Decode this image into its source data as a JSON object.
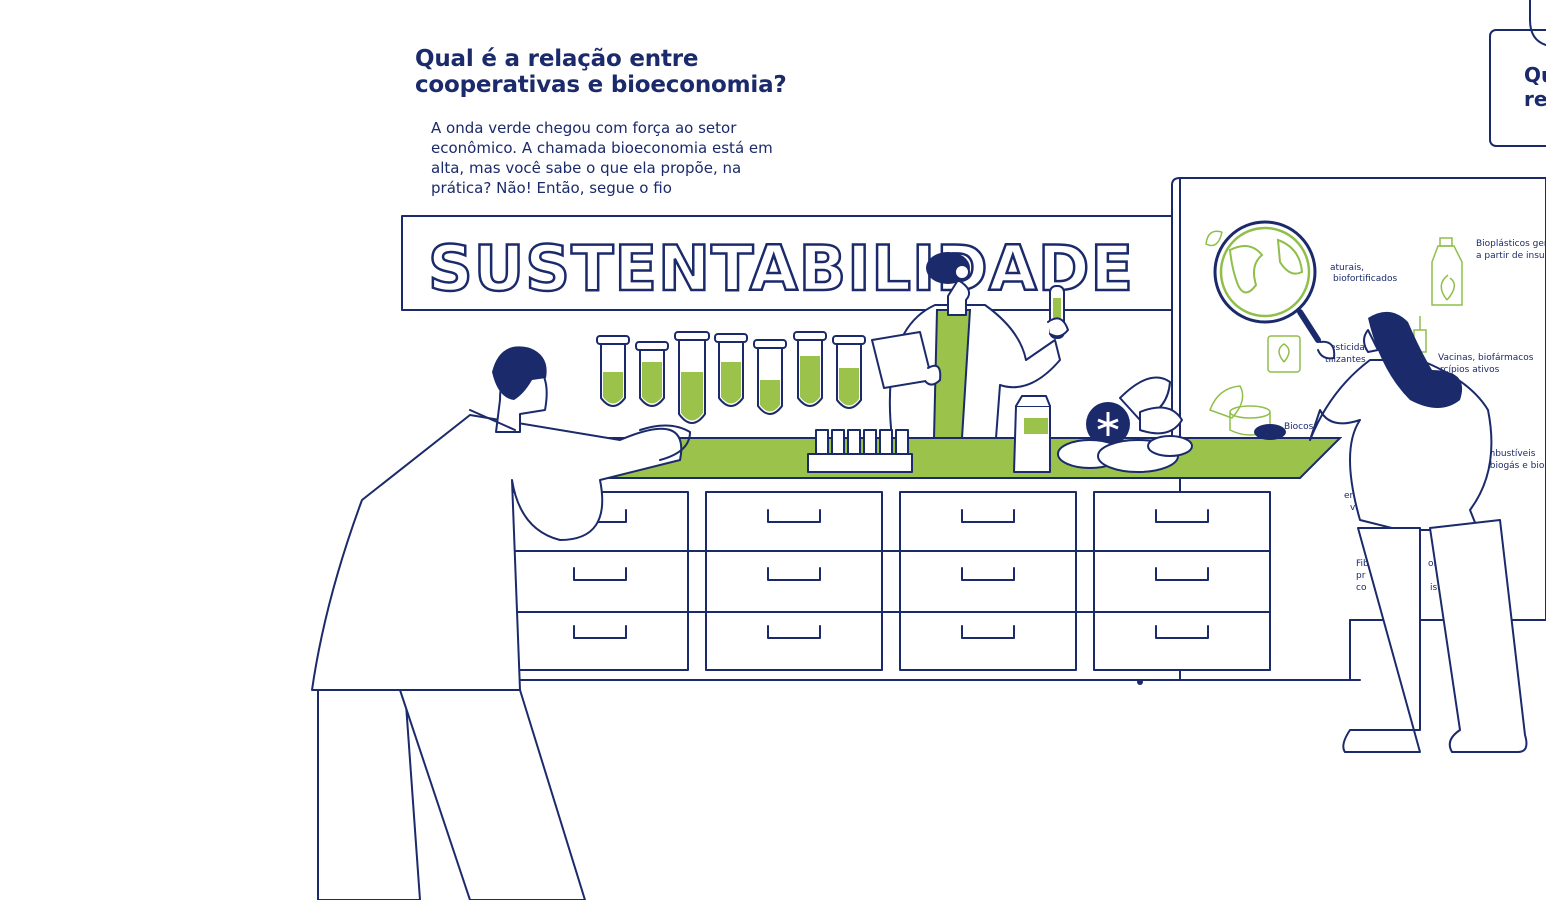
{
  "heading": {
    "line1": "Qual é a relação entre",
    "line2": "cooperativas e bioeconomia?"
  },
  "intro": {
    "line1": "A onda verde chegou com força ao setor",
    "line2": "econômico. A chamada bioeconomia está em",
    "line3": "alta, mas você sabe o que ela propõe, na",
    "line4": "prática? Não! Então, segue o fio"
  },
  "banner": {
    "word": "SUSTENTABILIDADE"
  },
  "next_card": {
    "line1": "Qu",
    "line2": "re"
  },
  "panel": {
    "label_alimentos_1": "aturais,",
    "label_alimentos_2": "biofortificados",
    "label_bioplasticos_1": "Bioplásticos gerac",
    "label_bioplasticos_2": "a partir de insumo",
    "label_pesticidas_1": "esticidas",
    "label_pesticidas_2": "tilizantes",
    "label_vacinas_1": "Vacinas, biofármacos",
    "label_vacinas_2": "rcípios ativos",
    "label_biocos": "Biocos",
    "label_combustiveis_1": "combustíveis",
    "label_combustiveis_2": "ol, biogás e biod",
    "label_energia_1": "energ",
    "label_energia_2": "váve",
    "label_fibras_1": "Fib",
    "label_fibras_2": "pr",
    "label_fibras_3": "co",
    "label_fibras_4": "ol",
    "label_fibras_5": "is"
  },
  "colors": {
    "ink": "#1b2a6b",
    "accent_green": "#9bc24a",
    "panel_green": "#8fbf4a",
    "background": "#ffffff"
  },
  "icons": [
    "magnifier-globe-icon",
    "plant-bottle-icon",
    "syringe-icon",
    "cosmetics-jar-icon",
    "milk-carton-icon",
    "test-tube-rack-icon"
  ]
}
